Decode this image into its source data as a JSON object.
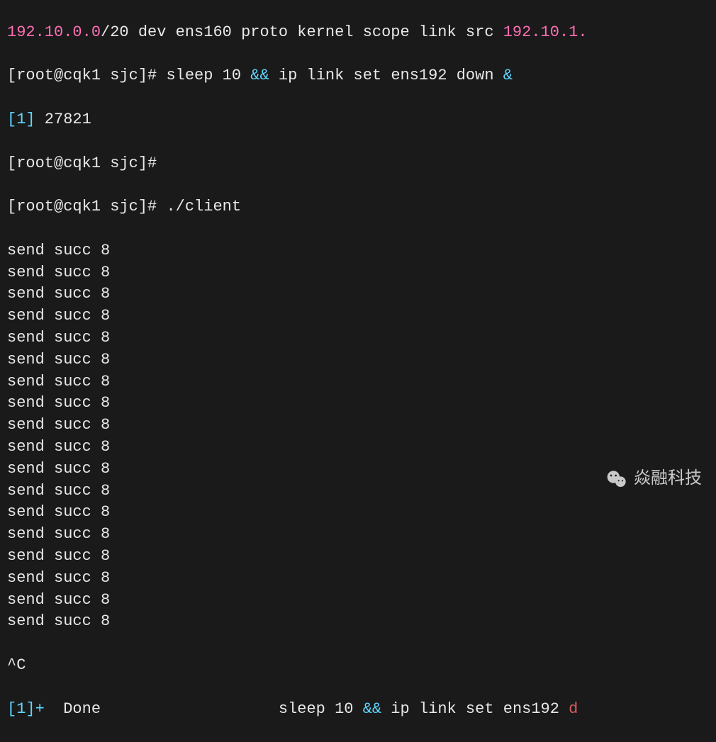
{
  "top_partial": {
    "ip_fragment": "192.10.0.0",
    "rest": "/20 dev ens160 proto kernel scope link src ",
    "end_ip": "192.10.1."
  },
  "lines": [
    {
      "prompt_open": "[",
      "user": "root@cqk1",
      "path": " sjc",
      "prompt_close": "]# ",
      "cmd_plain1": "sleep 10 ",
      "cmd_cyan": "&&",
      "cmd_plain2": " ip link set ens192 down ",
      "cmd_cyan2": "&"
    }
  ],
  "job_line": {
    "bracket_open": "[",
    "job_num": "1",
    "bracket_close": "]",
    "pid": " 27821"
  },
  "prompt2": {
    "prompt_open": "[",
    "user": "root@cqk1",
    "path": " sjc",
    "prompt_close": "]#"
  },
  "prompt3": {
    "prompt_open": "[",
    "user": "root@cqk1",
    "path": " sjc",
    "prompt_close": "]# ",
    "cmd": "./client"
  },
  "send_succ": "send succ 8",
  "interrupt": "^C",
  "done_line": {
    "bracket_open": "[",
    "job_num": "1",
    "bracket_close": "]+",
    "spacer": "  ",
    "status": "Done",
    "gap": "                   ",
    "cmd_plain1": "sleep 10 ",
    "cmd_cyan": "&&",
    "cmd_plain2": " ip link set ens192 ",
    "cmd_red": "d"
  },
  "watermark": {
    "text": "焱融科技"
  },
  "repeat_count": 18
}
